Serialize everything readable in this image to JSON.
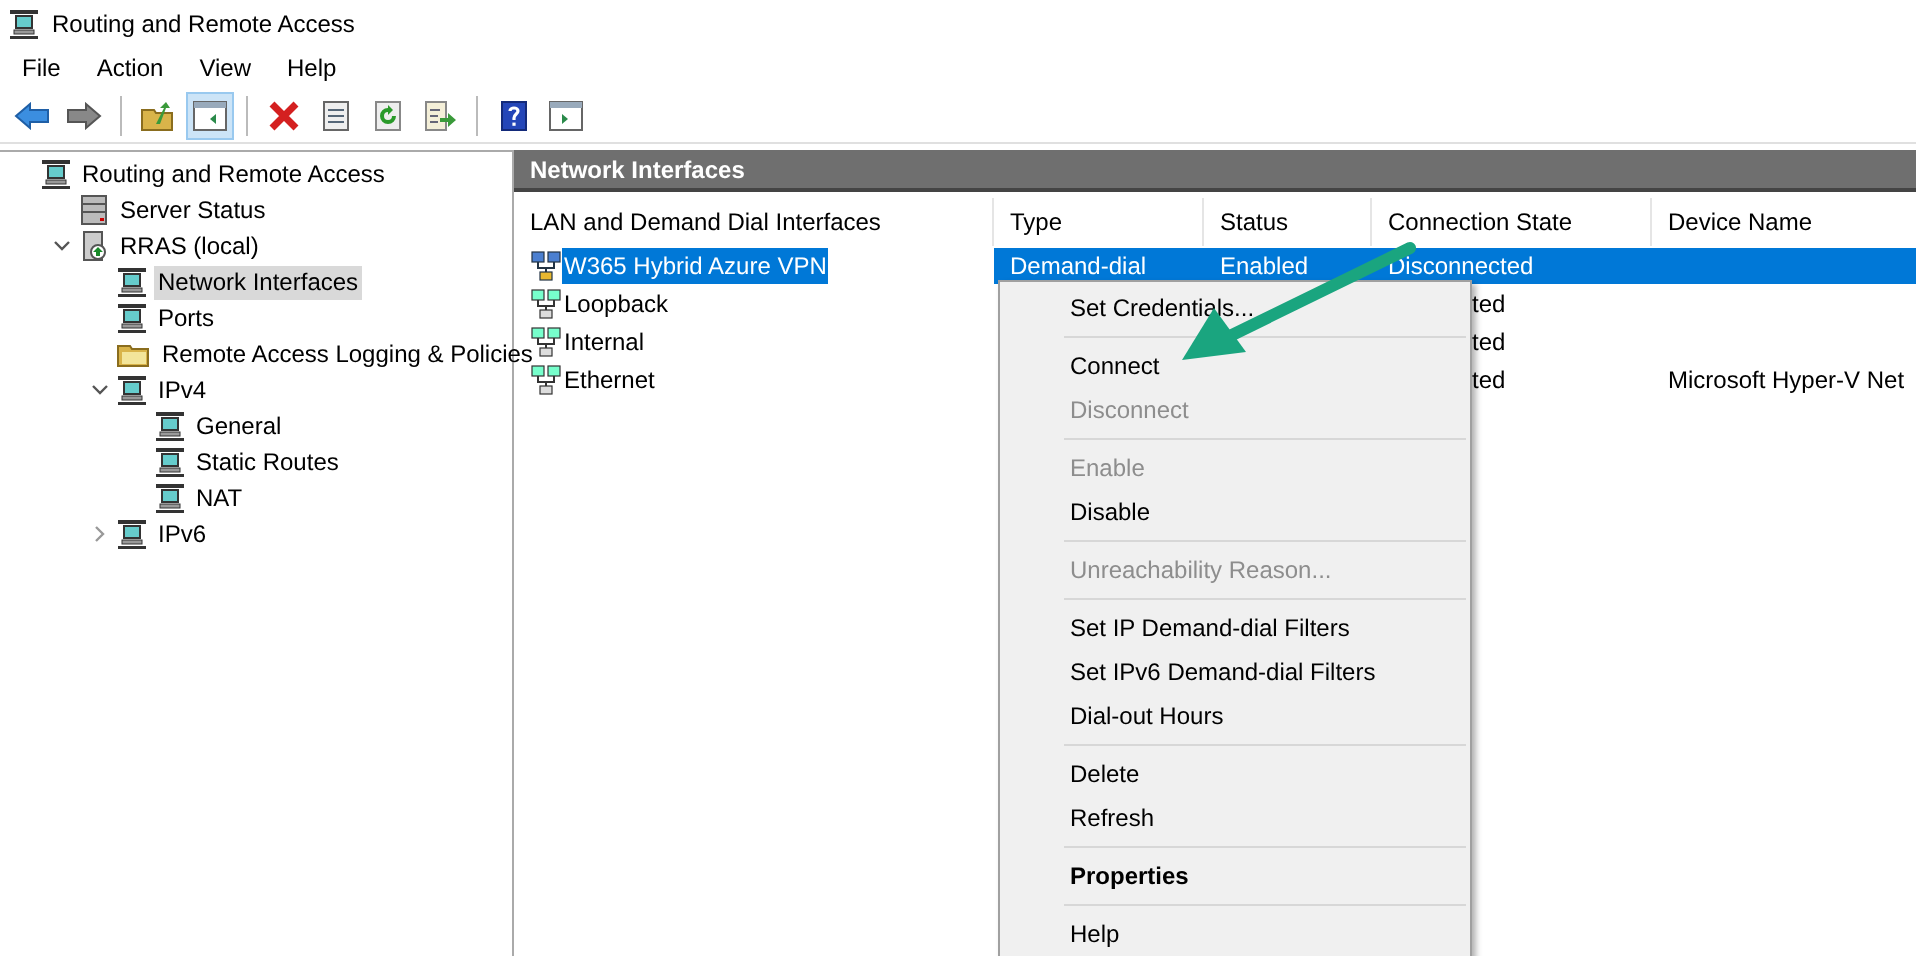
{
  "window": {
    "title": "Routing and Remote Access"
  },
  "menu_bar": [
    "File",
    "Action",
    "View",
    "Help"
  ],
  "toolbar": [
    {
      "kind": "back",
      "pressed": false
    },
    {
      "kind": "forward",
      "pressed": false
    },
    {
      "kind": "separator"
    },
    {
      "kind": "up",
      "pressed": false
    },
    {
      "kind": "tree",
      "pressed": true
    },
    {
      "kind": "separator"
    },
    {
      "kind": "delete",
      "pressed": false
    },
    {
      "kind": "properties",
      "pressed": false
    },
    {
      "kind": "refresh",
      "pressed": false
    },
    {
      "kind": "export",
      "pressed": false
    },
    {
      "kind": "separator"
    },
    {
      "kind": "help",
      "pressed": false
    },
    {
      "kind": "pane",
      "pressed": false
    }
  ],
  "tree": [
    {
      "label": "Routing and Remote Access",
      "kind": "computer",
      "selected": false,
      "children": [
        {
          "label": "Server Status",
          "kind": "servers",
          "selected": false
        },
        {
          "label": "RRAS (local)",
          "kind": "server",
          "selected": false,
          "expanded": true,
          "children": [
            {
              "label": "Network Interfaces",
              "kind": "computer",
              "selected": true
            },
            {
              "label": "Ports",
              "kind": "computer",
              "selected": false
            },
            {
              "label": "Remote Access Logging & Policies",
              "kind": "folder",
              "selected": false
            },
            {
              "label": "IPv4",
              "kind": "computer",
              "selected": false,
              "expanded": true,
              "children": [
                {
                  "label": "General",
                  "kind": "computer",
                  "selected": false
                },
                {
                  "label": "Static Routes",
                  "kind": "computer",
                  "selected": false
                },
                {
                  "label": "NAT",
                  "kind": "computer",
                  "selected": false
                }
              ]
            },
            {
              "label": "IPv6",
              "kind": "computer",
              "selected": false,
              "expanded": false
            }
          ]
        }
      ]
    }
  ],
  "pane": {
    "title": "Network Interfaces",
    "columns": [
      "LAN and Demand Dial Interfaces",
      "Type",
      "Status",
      "Connection State",
      "Device Name"
    ],
    "rows": [
      {
        "selected": true,
        "kind": "vpn",
        "cells": [
          "W365 Hybrid Azure VPN",
          "Demand-dial",
          "Enabled",
          "Disconnected",
          ""
        ]
      },
      {
        "selected": false,
        "kind": "lan",
        "cells": [
          "Loopback",
          "",
          "",
          "ted",
          ""
        ]
      },
      {
        "selected": false,
        "kind": "lan",
        "cells": [
          "Internal",
          "",
          "",
          "ted",
          ""
        ]
      },
      {
        "selected": false,
        "kind": "lan",
        "cells": [
          "Ethernet",
          "",
          "",
          "ted",
          "Microsoft Hyper-V Net"
        ]
      }
    ]
  },
  "context_menu": [
    {
      "kind": "item",
      "label": "Set Credentials...",
      "disabled": false,
      "default": false
    },
    {
      "kind": "separator"
    },
    {
      "kind": "item",
      "label": "Connect",
      "disabled": false,
      "default": false
    },
    {
      "kind": "item",
      "label": "Disconnect",
      "disabled": true,
      "default": false
    },
    {
      "kind": "separator"
    },
    {
      "kind": "item",
      "label": "Enable",
      "disabled": true,
      "default": false
    },
    {
      "kind": "item",
      "label": "Disable",
      "disabled": false,
      "default": false
    },
    {
      "kind": "separator"
    },
    {
      "kind": "item",
      "label": "Unreachability Reason...",
      "disabled": true,
      "default": false
    },
    {
      "kind": "separator"
    },
    {
      "kind": "item",
      "label": "Set IP Demand-dial Filters",
      "disabled": false,
      "default": false
    },
    {
      "kind": "item",
      "label": "Set IPv6 Demand-dial Filters",
      "disabled": false,
      "default": false
    },
    {
      "kind": "item",
      "label": "Dial-out Hours",
      "disabled": false,
      "default": false
    },
    {
      "kind": "separator"
    },
    {
      "kind": "item",
      "label": "Delete",
      "disabled": false,
      "default": false
    },
    {
      "kind": "item",
      "label": "Refresh",
      "disabled": false,
      "default": false
    },
    {
      "kind": "separator"
    },
    {
      "kind": "item",
      "label": "Properties",
      "disabled": false,
      "default": true
    },
    {
      "kind": "separator"
    },
    {
      "kind": "item",
      "label": "Help",
      "disabled": false,
      "default": false
    }
  ]
}
